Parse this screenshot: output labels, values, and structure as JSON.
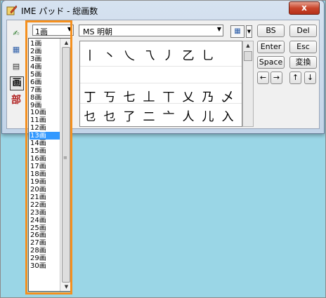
{
  "window": {
    "title": "IME パッド - 総画数",
    "close_glyph": "x"
  },
  "tools": [
    {
      "name": "handwriting-tool",
      "glyph": "✍",
      "color": "#2c7a2c"
    },
    {
      "name": "char-list-tool",
      "glyph": "▦",
      "color": "#2a5ca8"
    },
    {
      "name": "soft-keyboard-tool",
      "glyph": "▤",
      "color": "#333333"
    },
    {
      "name": "stroke-count-tool",
      "glyph": "画",
      "active": true
    },
    {
      "name": "radical-tool",
      "glyph": "部",
      "color": "#b02020"
    }
  ],
  "stroke_select": {
    "value": "1画"
  },
  "font_select": {
    "value": "MS 明朝"
  },
  "char_grid": {
    "rows": [
      [
        "丨",
        "丶",
        "乀",
        "乁",
        "丿",
        "乙",
        "乚"
      ],
      [],
      [
        "丁",
        "丂",
        "七",
        "丄",
        "丅",
        "乂",
        "乃",
        "乄"
      ],
      [
        "乜",
        "乜",
        "了",
        "二",
        "亠",
        "人",
        "儿",
        "入"
      ]
    ]
  },
  "keys": {
    "bs": "BS",
    "del": "Del",
    "enter": "Enter",
    "esc": "Esc",
    "space": "Space",
    "convert": "変換",
    "left": "←",
    "right": "→",
    "up": "↑",
    "down": "↓"
  },
  "stroke_list": {
    "items": [
      "1画",
      "2画",
      "3画",
      "4画",
      "5画",
      "6画",
      "7画",
      "8画",
      "9画",
      "10画",
      "11画",
      "12画",
      "13画",
      "14画",
      "15画",
      "16画",
      "17画",
      "18画",
      "19画",
      "20画",
      "21画",
      "22画",
      "23画",
      "24画",
      "25画",
      "26画",
      "27画",
      "28画",
      "29画",
      "30画"
    ],
    "selected_index": 12
  },
  "accent": {
    "highlight": "#f5901e",
    "selection": "#3399ff",
    "close": "#c9462c"
  }
}
